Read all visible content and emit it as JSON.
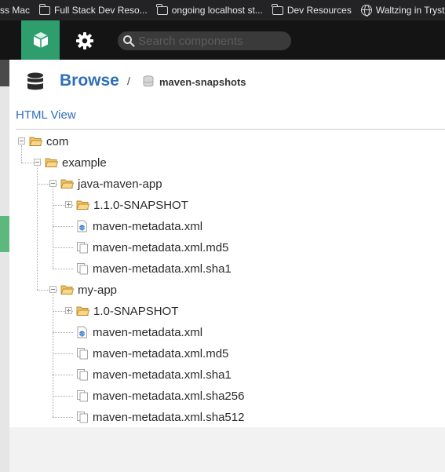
{
  "bookmarks": [
    {
      "label": "ss Mac",
      "icon": "none"
    },
    {
      "label": "Full Stack Dev Reso...",
      "icon": "folder-icon"
    },
    {
      "label": "ongoing localhost st...",
      "icon": "folder-icon"
    },
    {
      "label": "Dev Resources",
      "icon": "folder-icon"
    },
    {
      "label": "Waltzing in Tryst",
      "icon": "globe-icon"
    }
  ],
  "header": {
    "search_placeholder": "Search components",
    "accent_color": "#2e9e6e"
  },
  "breadcrumb": {
    "section": "Browse",
    "separator": "/",
    "repository": "maven-snapshots"
  },
  "view_link": "HTML View",
  "tree": [
    {
      "label": "com",
      "type": "folder",
      "state": "expanded"
    },
    {
      "label": "example",
      "type": "folder",
      "state": "expanded"
    },
    {
      "label": "java-maven-app",
      "type": "folder",
      "state": "expanded"
    },
    {
      "label": "1.1.0-SNAPSHOT",
      "type": "folder",
      "state": "collapsed"
    },
    {
      "label": "maven-metadata.xml",
      "type": "xml-file"
    },
    {
      "label": "maven-metadata.xml.md5",
      "type": "file"
    },
    {
      "label": "maven-metadata.xml.sha1",
      "type": "file"
    },
    {
      "label": "my-app",
      "type": "folder",
      "state": "expanded"
    },
    {
      "label": "1.0-SNAPSHOT",
      "type": "folder",
      "state": "collapsed"
    },
    {
      "label": "maven-metadata.xml",
      "type": "xml-file"
    },
    {
      "label": "maven-metadata.xml.md5",
      "type": "file"
    },
    {
      "label": "maven-metadata.xml.sha1",
      "type": "file"
    },
    {
      "label": "maven-metadata.xml.sha256",
      "type": "file"
    },
    {
      "label": "maven-metadata.xml.sha512",
      "type": "file"
    }
  ]
}
